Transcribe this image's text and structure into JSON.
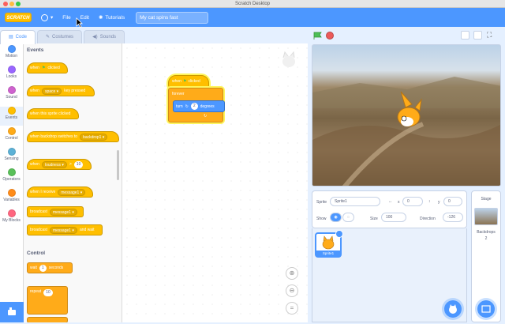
{
  "window": {
    "title": "Scratch Desktop"
  },
  "menu": {
    "logo": "SCRATCH",
    "file": "File",
    "edit": "Edit",
    "tutorials": "Tutorials",
    "project_title": "My cat spins fast"
  },
  "tabs": {
    "code": "Code",
    "costumes": "Costumes",
    "sounds": "Sounds"
  },
  "categories": [
    {
      "label": "Motion",
      "color": "#4c97ff"
    },
    {
      "label": "Looks",
      "color": "#9966ff"
    },
    {
      "label": "Sound",
      "color": "#cf63cf"
    },
    {
      "label": "Events",
      "color": "#ffbf00"
    },
    {
      "label": "Control",
      "color": "#ffab19"
    },
    {
      "label": "Sensing",
      "color": "#5cb1d6"
    },
    {
      "label": "Operators",
      "color": "#59c059"
    },
    {
      "label": "Variables",
      "color": "#ff8c1a"
    },
    {
      "label": "My Blocks",
      "color": "#ff6680"
    }
  ],
  "palette": {
    "events_header": "Events",
    "control_header": "Control",
    "blocks": {
      "when_flag": "when",
      "when_flag_suffix": "clicked",
      "when_key": "when",
      "key_value": "space",
      "key_suffix": "key pressed",
      "sprite_clicked": "when this sprite clicked",
      "backdrop_switch": "when backdrop switches to",
      "backdrop_value": "backdrop1",
      "when_loudness": "when",
      "loudness_value": "loudness",
      "loudness_op": ">",
      "loudness_num": "10",
      "receive": "when I receive",
      "receive_value": "message1",
      "broadcast": "broadcast",
      "broadcast_value": "message1",
      "broadcast_wait": "broadcast",
      "broadcast_wait_value": "message1",
      "broadcast_wait_suffix": "and wait",
      "wait": "wait",
      "wait_num": "1",
      "wait_suffix": "seconds",
      "repeat": "repeat",
      "repeat_num": "10"
    }
  },
  "script": {
    "hat_when": "when",
    "hat_clicked": "clicked",
    "forever": "forever",
    "turn": "turn",
    "turn_num": "2",
    "degrees": "degrees"
  },
  "sprite_info": {
    "sprite_label": "Sprite",
    "sprite_name": "Sprite1",
    "x_label": "x",
    "x_value": "0",
    "y_label": "y",
    "y_value": "0",
    "show_label": "Show",
    "size_label": "Size",
    "size_value": "100",
    "direction_label": "Direction",
    "direction_value": "-126"
  },
  "sprite_list": [
    {
      "name": "Sprite1"
    }
  ],
  "stage_pane": {
    "title": "Stage",
    "backdrops_label": "Backdrops",
    "backdrops_count": "2"
  },
  "colors": {
    "accent": "#4c97ff",
    "events": "#ffbf00",
    "control": "#ffab19",
    "motion": "#4c97ff"
  }
}
